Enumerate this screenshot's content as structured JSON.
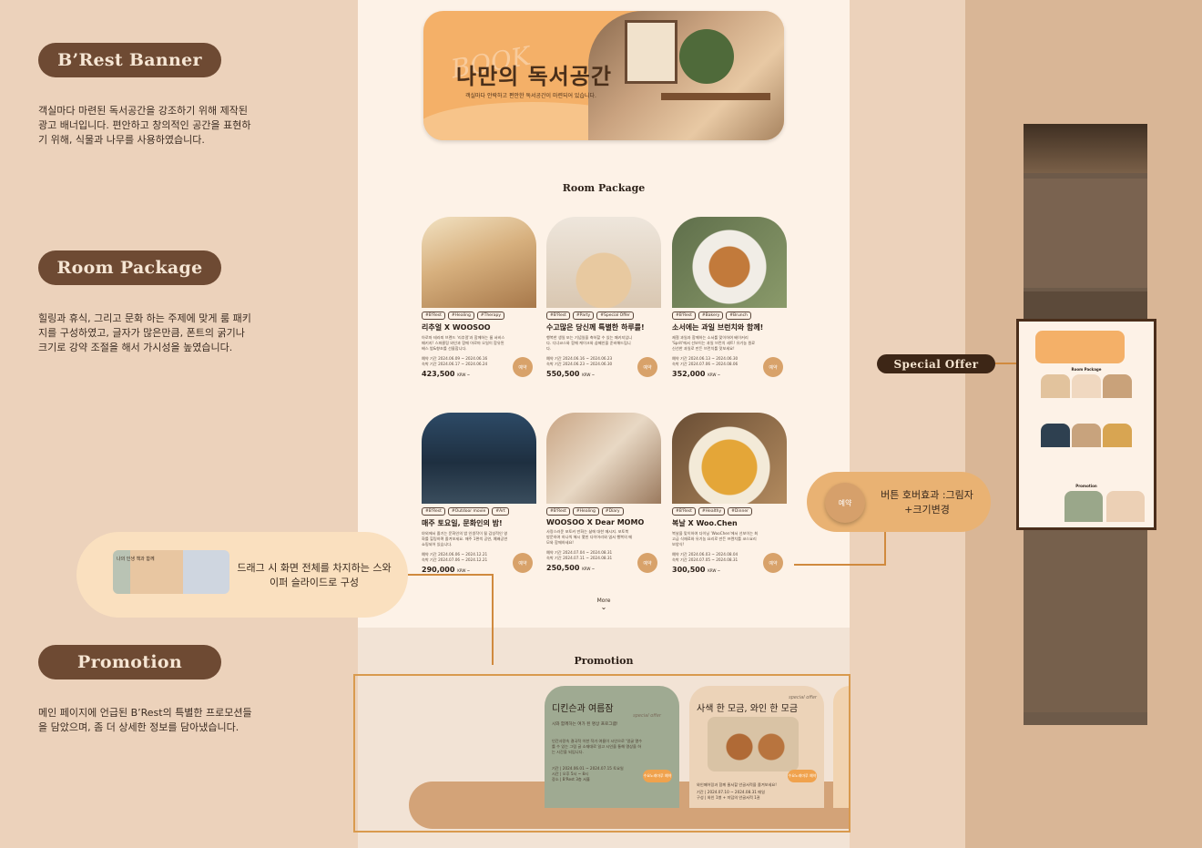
{
  "left": {
    "banner": {
      "label": "B’Rest Banner",
      "description": "객실마다 마련된 독서공간을 강조하기 위해 제작된 광고 배너입니다. 편안하고 창의적인 공간을 표현하기 위해, 식물과 나무를 사용하였습니다."
    },
    "room_package": {
      "label": "Room Package",
      "description": "힐링과 휴식, 그리고 문화 하는 주제에 맞게 룸 패키지를 구성하였고, 글자가 많은만큼, 폰트의 굵기나 크기로 강약 조절을 해서 가시성을 높였습니다."
    },
    "promotion": {
      "label": "Promotion",
      "description": "메인 페이지에 언급된 B’Rest의 특별한 프로모션들을 담았으며, 좀 더 상세한 정보를 담아냈습니다."
    }
  },
  "banner": {
    "title": "나만의 독서공간",
    "subtitle": "객실마다 안락하고 편안한 독서공간이 마련되어 있습니다.",
    "background_text": "BOOK"
  },
  "room_package": {
    "title": "Room Package",
    "book_label": "예약",
    "currency": "KRW ~",
    "cards": [
      {
        "tags": [
          "#B'Rest",
          "#Healing",
          "#Therapy"
        ],
        "title": "리추얼 X WOOSOO",
        "desc": "아로마 테라피 브랜드 '리추얼'과 함께하는 룸 서비스 패키지! 스파클링 와인과 함께 아로마 오일이 함유된 배스 밤&향초를 선물합니다.",
        "dates": "예약 기간 2024.06.09 ~ 2024.06.16\n숙박 기간 2024.06.17 ~ 2024.06.24",
        "price": "423,500",
        "img": "a"
      },
      {
        "tags": [
          "#B'Rest",
          "#Party",
          "#Special Offer"
        ],
        "title": "수고많은 당신께 특별한 하루를!",
        "desc": "행복한 생일 또는 기념일을 축하할 수 있는 패키지입니다. 디너코스와 함께 케이크와 샴페인을 준비해드립니다.",
        "dates": "예약 기간 2024.06.16 ~ 2024.06.23\n숙박 기간 2024.06.23 ~ 2024.06.30",
        "price": "550,500",
        "img": "b"
      },
      {
        "tags": [
          "#B'Rest",
          "#Bakery",
          "#Brunch"
        ],
        "title": "소서에는 과일 브런치와 함께!",
        "desc": "제철 과일과 함께하는 소서를 맞이하여 베이커리 'Sprit'에서 선보이는 과일 브런치 세트! 유기농 원료 신선한 과일로 만든 브런치를 맛보세요!",
        "dates": "예약 기간 2024.06.13 ~ 2024.06.30\n숙박 기간 2024.07.06 ~ 2024.08.06",
        "price": "352,000",
        "img": "c"
      },
      {
        "tags": [
          "#B'Rest",
          "#Outdoor movie",
          "#Art"
        ],
        "title": "매주 토요일, 문화인의 밤!",
        "desc": "야외에서 즐기는 문화인의 밤 인생작이 될 감성적인 영화를 힐링하며 즐겨보세요. 매주 1편씩 공연, 예배공연 쇼핑되어 있습니다.",
        "dates": "예약 기간 2024.06.06 ~ 2024.12.21\n숙박 기간 2024.07.06 ~ 2024.12.21",
        "price": "290,000",
        "img": "d"
      },
      {
        "tags": [
          "#B'Rest",
          "#Healing",
          "#Diary"
        ],
        "title": "WOOSOO X Dear MOMO",
        "desc": "사랑스러운 포토커 만화는 삶에 대한 메시지. 포토북 방문하여 하나씩 해시 맺힌 다이어리와 엽서 행복의 메모와 함께하세요!",
        "dates": "예약 기간 2024.07.04 ~ 2024.08.31\n숙박 기간 2024.07.11 ~ 2024.08.31",
        "price": "250,500",
        "img": "e"
      },
      {
        "tags": [
          "#B'Rest",
          "#Healthy",
          "#Dinner"
        ],
        "title": "복날 X Woo.Chen",
        "desc": "복날을 맞이하여 다이닝 'WooChen'에서 선보이는 최고급 식재료와 유기농 요리로 만든 프렌치를 코스요리 보양식!",
        "dates": "예약 기간 2024.06.03 ~ 2024.08.04\n숙박 기간 2024.07.05 ~ 2024.08.31",
        "price": "300,500",
        "img": "f"
      }
    ],
    "more_label": "More"
  },
  "promotion": {
    "title": "Promotion",
    "cards": [
      {
        "title": "디킨슨과 여름잠",
        "special": "special offer",
        "sub": "시와 함께하는 여가 된 명상 프로그램!",
        "desc": "인간사랑속 결국적 이한 작가 여름이 시인으로 '얼굴 열수를 수 있는 그림 글 소재대로 일고 시인을 통해 명상을 하는 시간을 되입니다.",
        "dates": "기간 | 2024.06.01 ~ 2024.07.15 토요일\n시간 | 오후 5시 ~ 8시\n장소 | B'Rest 3층 서홀",
        "btn": "수요노래마루 예약"
      },
      {
        "title": "사색 한 모금, 와인 한 모금",
        "special": "special offer",
        "sub": "",
        "desc": "와인페어링과 함께 줄서할 안골서적을 즐겨보세요!",
        "dates": "기간 | 2024.07.10 ~ 2024.08.31 매일\n구성 | 와인 1병 + 미덥의 안골서적 1권",
        "btn": "수요노래마루 예약"
      }
    ]
  },
  "callouts": {
    "drag": "드래그 시 화면 전체를 차지하는 스와이퍼 슬라이드로 구성",
    "hover_btn": "예약",
    "hover": "버튼 호버효과 :그림자+크기변경",
    "thumb_text": "나의 인생 책과 함께"
  },
  "right": {
    "special_offer": "Special Offer",
    "mini_room_title": "Room Package",
    "mini_promo_title": "Promotion"
  },
  "colors": {
    "background": "#ecd2bb",
    "page": "#fdf2e7",
    "pill": "#6e4a33",
    "accent": "#d99a4e",
    "banner": "#f4b068"
  }
}
